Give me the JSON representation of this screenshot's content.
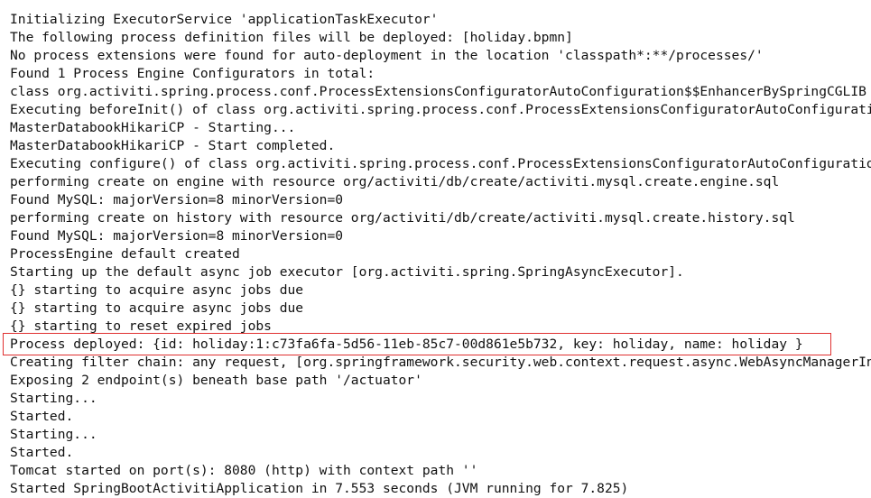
{
  "console": {
    "lines": [
      "Initializing ExecutorService 'applicationTaskExecutor'",
      "The following process definition files will be deployed: [holiday.bpmn]",
      "No process extensions were found for auto-deployment in the location 'classpath*:**/processes/'",
      "Found 1 Process Engine Configurators in total:",
      "class org.activiti.spring.process.conf.ProcessExtensionsConfiguratorAutoConfiguration$$EnhancerBySpringCGLIB",
      "Executing beforeInit() of class org.activiti.spring.process.conf.ProcessExtensionsConfiguratorAutoConfiguration",
      "MasterDatabookHikariCP - Starting...",
      "MasterDatabookHikariCP - Start completed.",
      "Executing configure() of class org.activiti.spring.process.conf.ProcessExtensionsConfiguratorAutoConfiguration",
      "performing create on engine with resource org/activiti/db/create/activiti.mysql.create.engine.sql",
      "Found MySQL: majorVersion=8 minorVersion=0",
      "performing create on history with resource org/activiti/db/create/activiti.mysql.create.history.sql",
      "Found MySQL: majorVersion=8 minorVersion=0",
      "ProcessEngine default created",
      "Starting up the default async job executor [org.activiti.spring.SpringAsyncExecutor].",
      "{} starting to acquire async jobs due",
      "{} starting to acquire async jobs due",
      "{} starting to reset expired jobs",
      "Process deployed: {id: holiday:1:c73fa6fa-5d56-11eb-85c7-00d861e5b732, key: holiday, name: holiday }",
      "Creating filter chain: any request, [org.springframework.security.web.context.request.async.WebAsyncManagerIntegrationFilter",
      "Exposing 2 endpoint(s) beneath base path '/actuator'",
      "Starting...",
      "Started.",
      "Starting...",
      "Started.",
      "Tomcat started on port(s): 8080 (http) with context path ''",
      "Started SpringBootActivitiApplication in 7.553 seconds (JVM running for 7.825)"
    ],
    "highlight_color": "#e03030"
  }
}
